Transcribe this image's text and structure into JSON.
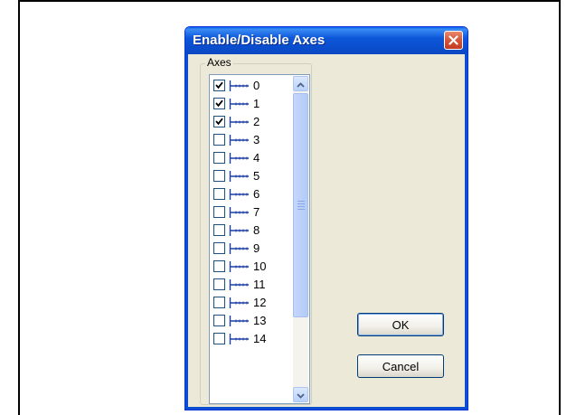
{
  "dialog": {
    "title": "Enable/Disable Axes",
    "group_label": "Axes",
    "ok_label": "OK",
    "cancel_label": "Cancel"
  },
  "axes": [
    {
      "label": "0",
      "checked": true
    },
    {
      "label": "1",
      "checked": true
    },
    {
      "label": "2",
      "checked": true
    },
    {
      "label": "3",
      "checked": false
    },
    {
      "label": "4",
      "checked": false
    },
    {
      "label": "5",
      "checked": false
    },
    {
      "label": "6",
      "checked": false
    },
    {
      "label": "7",
      "checked": false
    },
    {
      "label": "8",
      "checked": false
    },
    {
      "label": "9",
      "checked": false
    },
    {
      "label": "10",
      "checked": false
    },
    {
      "label": "11",
      "checked": false
    },
    {
      "label": "12",
      "checked": false
    },
    {
      "label": "13",
      "checked": false
    },
    {
      "label": "14",
      "checked": false
    }
  ],
  "icons": {
    "close": "close-icon",
    "axis": "axis-icon",
    "checkmark": "checkmark-icon",
    "scroll_up": "chevron-up-icon",
    "scroll_down": "chevron-down-icon"
  },
  "colors": {
    "titlebar": "#0a4fd0",
    "dialog_bg": "#ECE9D8",
    "close_button": "#d5553a",
    "axis_icon": "#1c3fa8"
  }
}
